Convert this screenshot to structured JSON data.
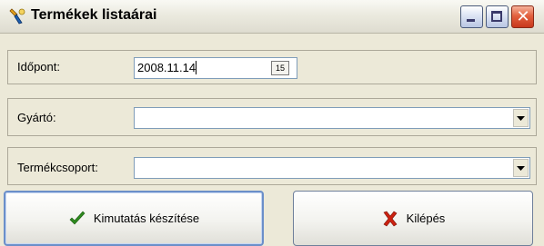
{
  "window": {
    "title": "Termékek listaárai",
    "buttons": {
      "minimize": "minimize",
      "maximize": "maximize",
      "close": "close"
    }
  },
  "form": {
    "date": {
      "label": "Időpont:",
      "value": "2008.11.14",
      "calendar_button_label": "15"
    },
    "manufacturer": {
      "label": "Gyártó:",
      "value": ""
    },
    "product_group": {
      "label": "Termékcsoport:",
      "value": ""
    }
  },
  "actions": {
    "report_label": "Kimutatás készítése",
    "exit_label": "Kilépés"
  },
  "icons": {
    "app": "app-icon",
    "calendar": "calendar-icon",
    "dropdown": "chevron-down-icon",
    "report": "checkmark-icon",
    "exit": "x-icon"
  },
  "colors": {
    "window_bg": "#ece9d8",
    "close_button": "#d9532f",
    "check": "#2e8b1e",
    "x_mark": "#cc2211"
  }
}
